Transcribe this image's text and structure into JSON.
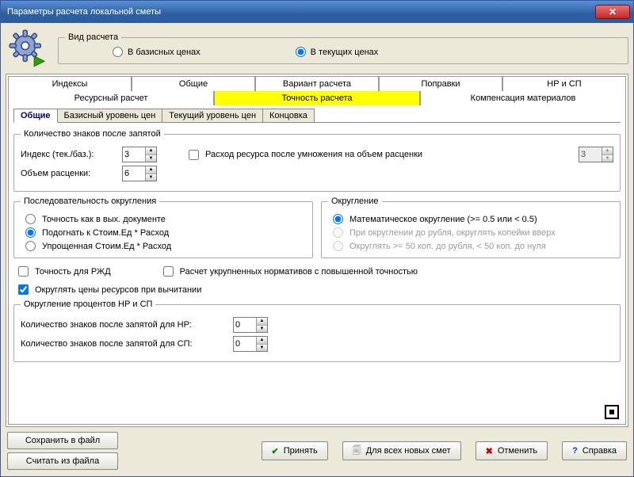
{
  "window": {
    "title": "Параметры расчета локальной сметы"
  },
  "calc_type": {
    "legend": "Вид расчета",
    "opt_basic": "В базисных ценах",
    "opt_current": "В текущих ценах",
    "selected": "current"
  },
  "tabs_row1": [
    "Индексы",
    "Общие",
    "Вариант расчета",
    "Поправки",
    "НР и СП"
  ],
  "tabs_row2": [
    "Ресурсный расчет",
    "Точность расчета",
    "Компенсация материалов"
  ],
  "subtabs": [
    "Общие",
    "Базисный уровень цен",
    "Текущий уровень цен",
    "Концовка"
  ],
  "decimals": {
    "legend": "Количество знаков после запятой",
    "index_label": "Индекс (тек./баз.):",
    "index_value": "3",
    "volume_label": "Объем расценки:",
    "volume_value": "6",
    "resource_checkbox": "Расход ресурса после умножения на объем расценки",
    "resource_value": "3"
  },
  "rounding_seq": {
    "legend": "Последовательность округления",
    "opt1": "Точность как в вых. документе",
    "opt2": "Подогнать к Стоим.Ед * Расход",
    "opt3": "Упрощенная Стоим.Ед * Расход"
  },
  "rounding": {
    "legend": "Округление",
    "opt1": "Математическое округление (>= 0.5 или < 0.5)",
    "opt2": "При округлении до рубля, округлять копейки вверх",
    "opt3": "Округлять >= 50 коп. до рубля, < 50 коп. до нуля"
  },
  "checks": {
    "rzhd": "Точность для РЖД",
    "ukrupn": "Расчет укрупненных нормативов с повышенной точностью",
    "round_prices": "Округлять цены ресурсов при вычитании"
  },
  "nr_sp": {
    "legend": "Округление процентов НР и СП",
    "nr_label": "Количество знаков после запятой для НР:",
    "nr_value": "0",
    "sp_label": "Количество знаков после запятой для СП:",
    "sp_value": "0"
  },
  "buttons": {
    "save_file": "Сохранить в файл",
    "read_file": "Считать из файла",
    "accept": "Принять",
    "for_all_new": "Для всех новых смет",
    "cancel": "Отменить",
    "help": "Справка"
  }
}
